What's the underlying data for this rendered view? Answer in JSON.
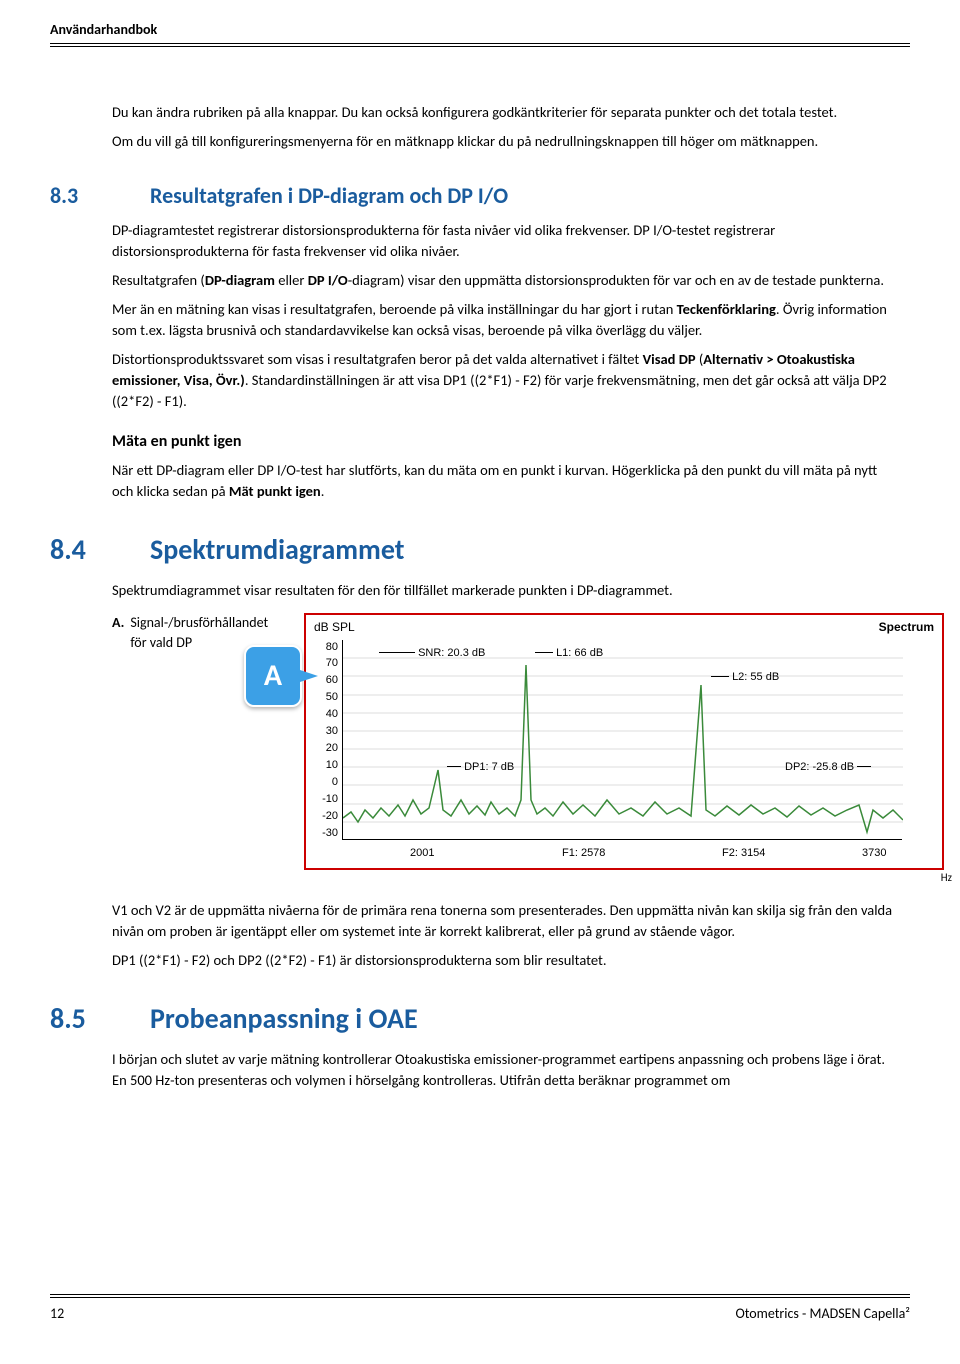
{
  "header": {
    "title": "Användarhandbok"
  },
  "intro": {
    "p1": "Du kan ändra rubriken på alla knappar. Du kan också konfigurera godkäntkriterier för separata punkter och det totala testet.",
    "p2": "Om du vill gå till konfigureringsmenyerna för en mätknapp klickar du på nedrullningsknappen till höger om mätknappen."
  },
  "sec83": {
    "num": "8.3",
    "title": "Resultatgrafen i DP-diagram och DP I/O",
    "p1": "DP-diagramtestet registrerar distorsionsprodukterna för fasta nivåer vid olika frekvenser. DP I/O-testet registrerar distorsionsprodukterna för fasta frekvenser vid olika nivåer.",
    "p2a": "Resultatgrafen (",
    "p2b": "DP-diagram",
    "p2c": " eller ",
    "p2d": "DP I/O",
    "p2e": "-diagram) visar den uppmätta distorsionsprodukten för var och en av de testade punkterna.",
    "p3a": "Mer än en mätning kan visas i resultatgrafen, beroende på vilka inställningar du har gjort i rutan ",
    "p3b": "Teckenförklaring",
    "p3c": ". Övrig information som t.ex. lägsta brusnivå och standardavvikelse kan också visas, beroende på vilka överlägg du väljer.",
    "p4a": "Distortionsproduktssvaret som visas i resultatgrafen beror på det valda alternativet i fältet ",
    "p4b": "Visad DP",
    "p4c": " (",
    "p4d": "Alternativ > Otoakustiska emissioner, Visa, Övr.)",
    "p4e": ". Standardinställningen är att visa DP1 ((2*F1) - F2) för varje frekvensmätning, men det går också att välja DP2 ((2*F2) - F1).",
    "h4": "Mäta en punkt igen",
    "p5a": "När ett DP-diagram eller DP I/O-test har slutförts, kan du mäta om en punkt i kurvan. Högerklicka på den punkt du vill mäta på nytt och klicka sedan på ",
    "p5b": "Mät punkt igen",
    "p5c": "."
  },
  "sec84": {
    "num": "8.4",
    "title": "Spektrumdiagrammet",
    "p1": "Spektrumdiagrammet visar resultaten för den för tillfället markerade punkten i DP-diagrammet.",
    "legend": {
      "letter": "A.",
      "text": "Signal-/brusförhållandet för vald DP"
    },
    "callout": "A",
    "p2": "V1 och V2 är de uppmätta nivåerna för de primära rena tonerna som presenterades. Den uppmätta nivån kan skilja sig från den valda nivån om proben är igentäppt eller om systemet inte är korrekt kalibrerat, eller på grund av stående vågor.",
    "p3": "DP1 ((2*F1) - F2) och DP2 ((2*F2) - F1) är distorsionsprodukterna som blir resultatet."
  },
  "sec85": {
    "num": "8.5",
    "title": "Probeanpassning i OAE",
    "p1": "I början och slutet av varje mätning kontrollerar Otoakustiska emissioner-programmet eartipens anpassning och probens läge i örat. En 500 Hz-ton presenteras och volymen i hörselgång kontrolleras. Utifrån detta beräknar programmet om"
  },
  "chart_data": {
    "type": "line",
    "title": "Spectrum",
    "ylabel": "dB SPL",
    "xlabel": "Hz",
    "ylim": [
      -30,
      80
    ],
    "yticks": [
      80,
      70,
      60,
      50,
      40,
      30,
      20,
      10,
      0,
      -10,
      -20,
      -30
    ],
    "xticks": [
      2001,
      2578,
      3154,
      3730
    ],
    "xtick_labels": [
      "2001",
      "F1: 2578",
      "F2: 3154",
      "3730"
    ],
    "annotations": {
      "SNR": "SNR: 20.3 dB",
      "L1": "L1: 66 dB",
      "L2": "L2: 55 dB",
      "DP1": "DP1: 7 dB",
      "DP2": "DP2: -25.8 dB"
    },
    "peaks": [
      {
        "name": "DP1",
        "x": 2001,
        "y": 7
      },
      {
        "name": "L1",
        "x": 2578,
        "y": 66
      },
      {
        "name": "L2",
        "x": 3154,
        "y": 55
      },
      {
        "name": "DP2",
        "x": 3730,
        "y": -25.8
      }
    ],
    "noise_floor_approx": -13
  },
  "footer": {
    "page": "12",
    "product": "Otometrics - MADSEN Capella²"
  }
}
